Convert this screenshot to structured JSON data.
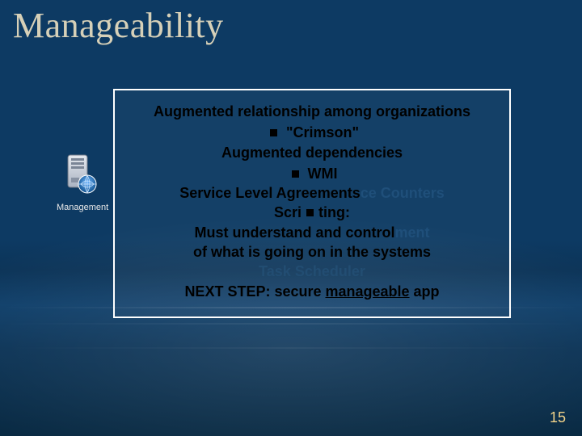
{
  "title": "Manageability",
  "icon": {
    "caption": "Management"
  },
  "content": {
    "l1": "Augmented relationship among organizations",
    "l2_bullet_after": "\"Crimson\"",
    "l3": "Augmented dependencies",
    "l4_bullet_after": "WMI",
    "l5_a": "Service Level Agreements",
    "l5_b_faded": "ce Counters",
    "l6_a": "Scri",
    "l6_b": "ting:",
    "l7_a": "Must understand and control",
    "l7_b_faded": "ment",
    "l8": "of what is going on in the systems",
    "l9_faded": "Task Scheduler",
    "l10_a": "NEXT STEP: secure ",
    "l10_b_u": "manageable",
    "l10_c": " app"
  },
  "page_number": "15"
}
